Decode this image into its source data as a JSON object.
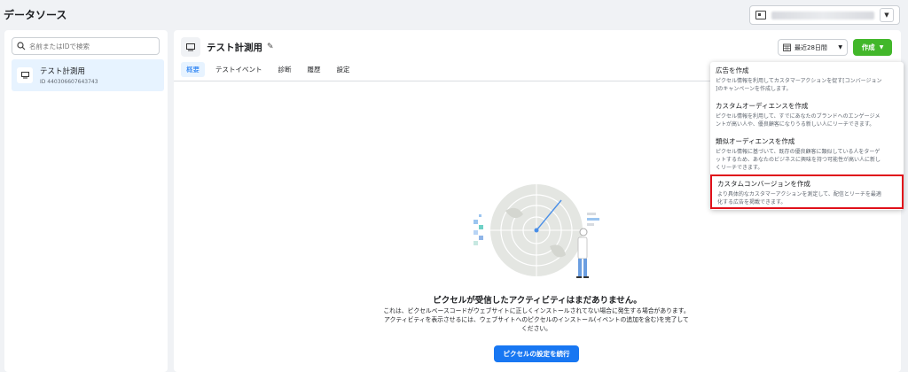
{
  "page": {
    "title": "データソース"
  },
  "account": {
    "blurred": true
  },
  "sidebar": {
    "search_placeholder": "名前またはIDで検索",
    "items": [
      {
        "name": "テスト計測用",
        "id": "ID 440306607643743",
        "selected": true
      }
    ]
  },
  "main": {
    "pixel_name": "テスト計測用",
    "tabs": [
      {
        "label": "概要",
        "active": true
      },
      {
        "label": "テストイベント"
      },
      {
        "label": "診断"
      },
      {
        "label": "履歴"
      },
      {
        "label": "設定"
      }
    ],
    "date_range": "最近28日間",
    "create_label": "作成",
    "empty_title": "ピクセルが受信したアクティビティはまだありません。",
    "empty_desc_1": "これは、ピクセルベースコードがウェブサイトに正しくインストールされてない場合に発生する場合があります。",
    "empty_desc_2": "アクティビティを表示させるには、ウェブサイトへのピクセルのインストール(イベントの追加を含む)を完了して",
    "empty_desc_3": "ください。",
    "continue_label": "ピクセルの設定を続行"
  },
  "dropdown": {
    "items": [
      {
        "title": "広告を作成",
        "desc": [
          "ピクセル情報を利用してカスタマーアクションを促す[コンバージョン",
          "]のキャンペーンを作成します。"
        ]
      },
      {
        "title": "カスタムオーディエンスを作成",
        "desc": [
          "ピクセル情報を利用して、すでにあなたのブランドへのエンゲージメ",
          "ントが高い人や、優良顧客になりうる新しい人にリーチできます。"
        ]
      },
      {
        "title": "類似オーディエンスを作成",
        "desc": [
          "ピクセル情報に基づいて、既存の優良顧客に類似している人をターゲ",
          "ットするため、あなたのビジネスに興味を持つ可能性が高い人に新し",
          "くリーチできます。"
        ]
      },
      {
        "title": "カスタムコンバージョンを作成",
        "desc": [
          "より具体的なカスタマーアクションを測定して、配信とリーチを最適",
          "化する広告を掲載できます。"
        ],
        "highlighted": true
      }
    ]
  },
  "colors": {
    "accent": "#1877f2",
    "create": "#42b72a",
    "highlight": "#e0101a"
  }
}
